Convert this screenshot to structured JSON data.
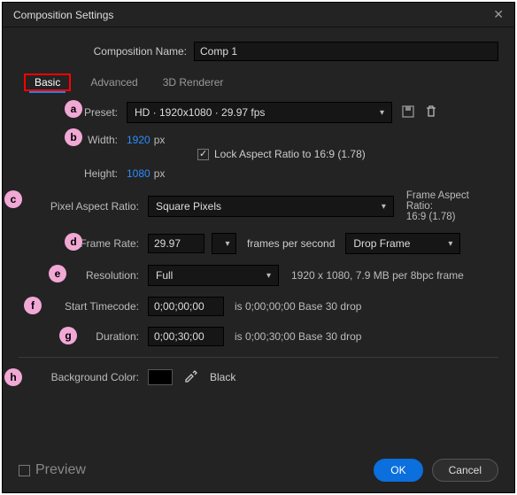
{
  "title": "Composition Settings",
  "compName": {
    "label": "Composition Name:",
    "value": "Comp 1"
  },
  "tabs": {
    "basic": "Basic",
    "advanced": "Advanced",
    "renderer": "3D Renderer"
  },
  "preset": {
    "label": "Preset:",
    "value": "HD · 1920x1080 · 29.97 fps"
  },
  "width": {
    "label": "Width:",
    "value": "1920",
    "unit": "px"
  },
  "height": {
    "label": "Height:",
    "value": "1080",
    "unit": "px"
  },
  "lockAspect": {
    "checked": true,
    "label": "Lock Aspect Ratio to 16:9 (1.78)"
  },
  "par": {
    "label": "Pixel Aspect Ratio:",
    "value": "Square Pixels",
    "frameLabel": "Frame Aspect Ratio:",
    "frameValue": "16:9 (1.78)"
  },
  "fps": {
    "label": "Frame Rate:",
    "value": "29.97",
    "unit": "frames per second",
    "drop": "Drop Frame"
  },
  "res": {
    "label": "Resolution:",
    "value": "Full",
    "info": "1920 x 1080, 7.9 MB per 8bpc frame"
  },
  "start": {
    "label": "Start Timecode:",
    "value": "0;00;00;00",
    "info": "is 0;00;00;00  Base 30   drop"
  },
  "dur": {
    "label": "Duration:",
    "value": "0;00;30;00",
    "info": "is 0;00;30;00  Base 30   drop"
  },
  "bg": {
    "label": "Background Color:",
    "name": "Black"
  },
  "preview": "Preview",
  "ok": "OK",
  "cancel": "Cancel",
  "markers": {
    "a": "a",
    "b": "b",
    "c": "c",
    "d": "d",
    "e": "e",
    "f": "f",
    "g": "g",
    "h": "h"
  }
}
